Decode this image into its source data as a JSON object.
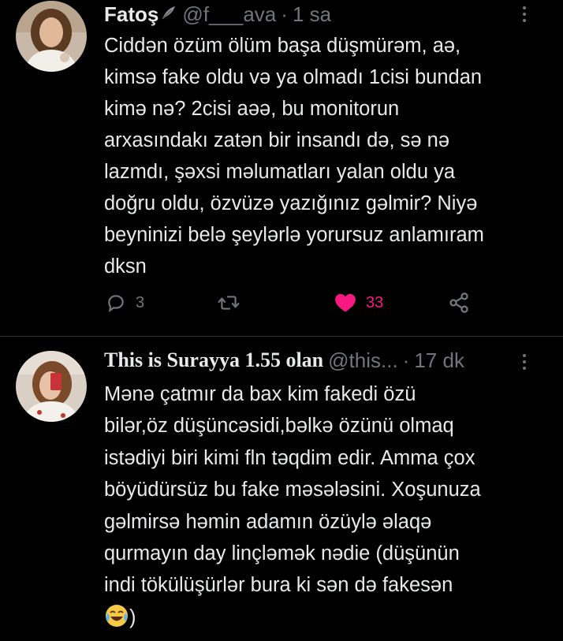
{
  "tweets": [
    {
      "name": "Fatoş",
      "handle": "@f___ava",
      "separator": "·",
      "time": "1 sa",
      "text": "Ciddən özüm ölüm başa düşmürəm, aə,\nkimsə fake oldu və ya olmadı 1cisi bundan\nkimə nə? 2cisi aəə, bu monitorun\narxasındakı zatən bir insandı də, sə nə\nlazmdı, şəxsi məlumatları yalan oldu ya\ndoğru oldu, özvüzə yazığınız gəlmir? Niyə\nbeyninizi belə şeylərlə yorursuz anlamıram\ndksn",
      "reply_count": "3",
      "retweet_count": "",
      "like_count": "33",
      "liked": true,
      "like_color": "#f91880"
    },
    {
      "name": "This is Surayya 1.55 olan",
      "handle": "@this...",
      "separator": "·",
      "time": "17 dk",
      "text": "Mənə çatmır da bax kim fakedi özü\nbilər,öz düşüncəsidi,bəlkə özünü olmaq\nistədiyi biri kimi fln təqdim edir. Amma çox\nböyüdürsüz bu fake məsələsini. Xoşunuza\ngəlmirsə həmin adamın özüylə əlaqə\nqurmayın day linçləmək nədie (düşünün\nindi tökülüşürlər bura ki sən də fakesən",
      "text_tail": ")"
    }
  ],
  "colors": {
    "background": "#000000",
    "text": "#e7e9ea",
    "muted": "#71767b",
    "divider": "#2f3336"
  },
  "icons": [
    "feather-emoji-icon",
    "more-icon",
    "reply-icon",
    "retweet-icon",
    "heart-icon",
    "share-icon",
    "crying-laughing-emoji-icon"
  ]
}
